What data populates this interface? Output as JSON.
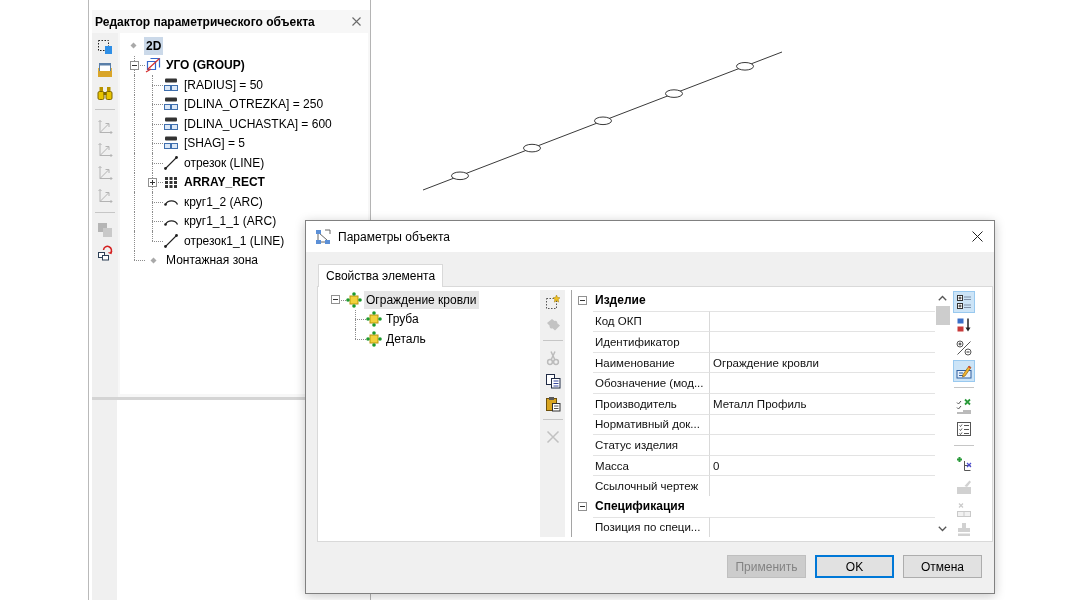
{
  "editor_panel": {
    "title": "Редактор параметрического объекта",
    "toolbar": [
      [
        {
          "disabled": false
        },
        {
          "disabled": false
        },
        {
          "disabled": false
        }
      ],
      [
        {
          "disabled": true
        },
        {
          "disabled": true
        },
        {
          "disabled": true
        },
        {
          "disabled": true
        }
      ],
      [
        {
          "disabled": true
        },
        {
          "disabled": false
        }
      ]
    ],
    "tree": [
      {
        "label": "2D",
        "kind": "view",
        "bold": true,
        "selected": true,
        "children": [
          {
            "label": "УГО (GROUP)",
            "kind": "group",
            "bold": true,
            "selected": false,
            "expanded": true,
            "children": [
              {
                "label": "[RADIUS] = 50",
                "kind": "variable",
                "bold": false,
                "selected": false
              },
              {
                "label": "[DLINA_OTREZKA] = 250",
                "kind": "variable",
                "bold": false,
                "selected": false
              },
              {
                "label": "[DLINA_UCHASTKA] = 600",
                "kind": "variable",
                "bold": false,
                "selected": false
              },
              {
                "label": "[SHAG] = 5",
                "kind": "variable",
                "bold": false,
                "selected": false
              },
              {
                "label": "отрезок (LINE)",
                "kind": "line",
                "bold": false,
                "selected": false
              },
              {
                "label": "ARRAY_RECT",
                "kind": "array",
                "bold": true,
                "selected": false,
                "expanded": false
              },
              {
                "label": "круг1_2 (ARC)",
                "kind": "arc",
                "bold": false,
                "selected": false
              },
              {
                "label": "круг1_1_1 (ARC)",
                "kind": "arc",
                "bold": false,
                "selected": false
              },
              {
                "label": "отрезок1_1 (LINE)",
                "kind": "line",
                "bold": false,
                "selected": false
              }
            ]
          },
          {
            "label": "Монтажная зона",
            "kind": "view",
            "bold": false,
            "selected": false
          }
        ]
      }
    ]
  },
  "dialog": {
    "title": "Параметры объекта",
    "tabs": [
      {
        "label": "Свойства элемента",
        "selected": true
      }
    ],
    "element_tree": [
      {
        "label": "Ограждение кровли",
        "selected": true,
        "expanded": true,
        "children": [
          {
            "label": "Труба",
            "selected": false
          },
          {
            "label": "Деталь",
            "selected": false
          }
        ]
      }
    ],
    "tree_toolbar": [
      [
        {
          "disabled": false
        },
        {
          "disabled": true
        }
      ],
      [
        {
          "disabled": true
        },
        {
          "disabled": false
        },
        {
          "disabled": false
        }
      ],
      [
        {
          "disabled": true
        }
      ]
    ],
    "properties": [
      {
        "category": "Изделие",
        "expanded": true,
        "rows": [
          {
            "name": "Код ОКП"
          },
          {
            "name": "Идентификатор"
          },
          {
            "name": "Наименование",
            "value": "Ограждение кровли"
          },
          {
            "name": "Обозначение (мод..."
          },
          {
            "name": "Производитель",
            "value": "Металл Профиль"
          },
          {
            "name": "Нормативный док..."
          },
          {
            "name": "Статус изделия"
          },
          {
            "name": "Масса",
            "value": "0"
          },
          {
            "name": "Ссылочный чертеж"
          }
        ]
      },
      {
        "category": "Спецификация",
        "expanded": true,
        "rows": [
          {
            "name": "Позиция по специ..."
          }
        ]
      }
    ],
    "grid_toolbar": [
      [
        {
          "selected": true,
          "disabled": false
        },
        {
          "selected": false,
          "disabled": false
        },
        {
          "selected": false,
          "disabled": false
        },
        {
          "selected": true,
          "disabled": false
        }
      ],
      [
        {
          "selected": false,
          "disabled": false
        },
        {
          "selected": false,
          "disabled": false
        }
      ],
      [
        {
          "selected": false,
          "disabled": false
        },
        {
          "selected": false,
          "disabled": true
        },
        {
          "selected": false,
          "disabled": true
        },
        {
          "selected": false,
          "disabled": true
        }
      ]
    ],
    "buttons": [
      {
        "label": "Применить",
        "disabled": true,
        "default": false
      },
      {
        "label": "OK",
        "disabled": false,
        "default": true
      },
      {
        "label": "Отмена",
        "disabled": false,
        "default": false
      }
    ]
  }
}
